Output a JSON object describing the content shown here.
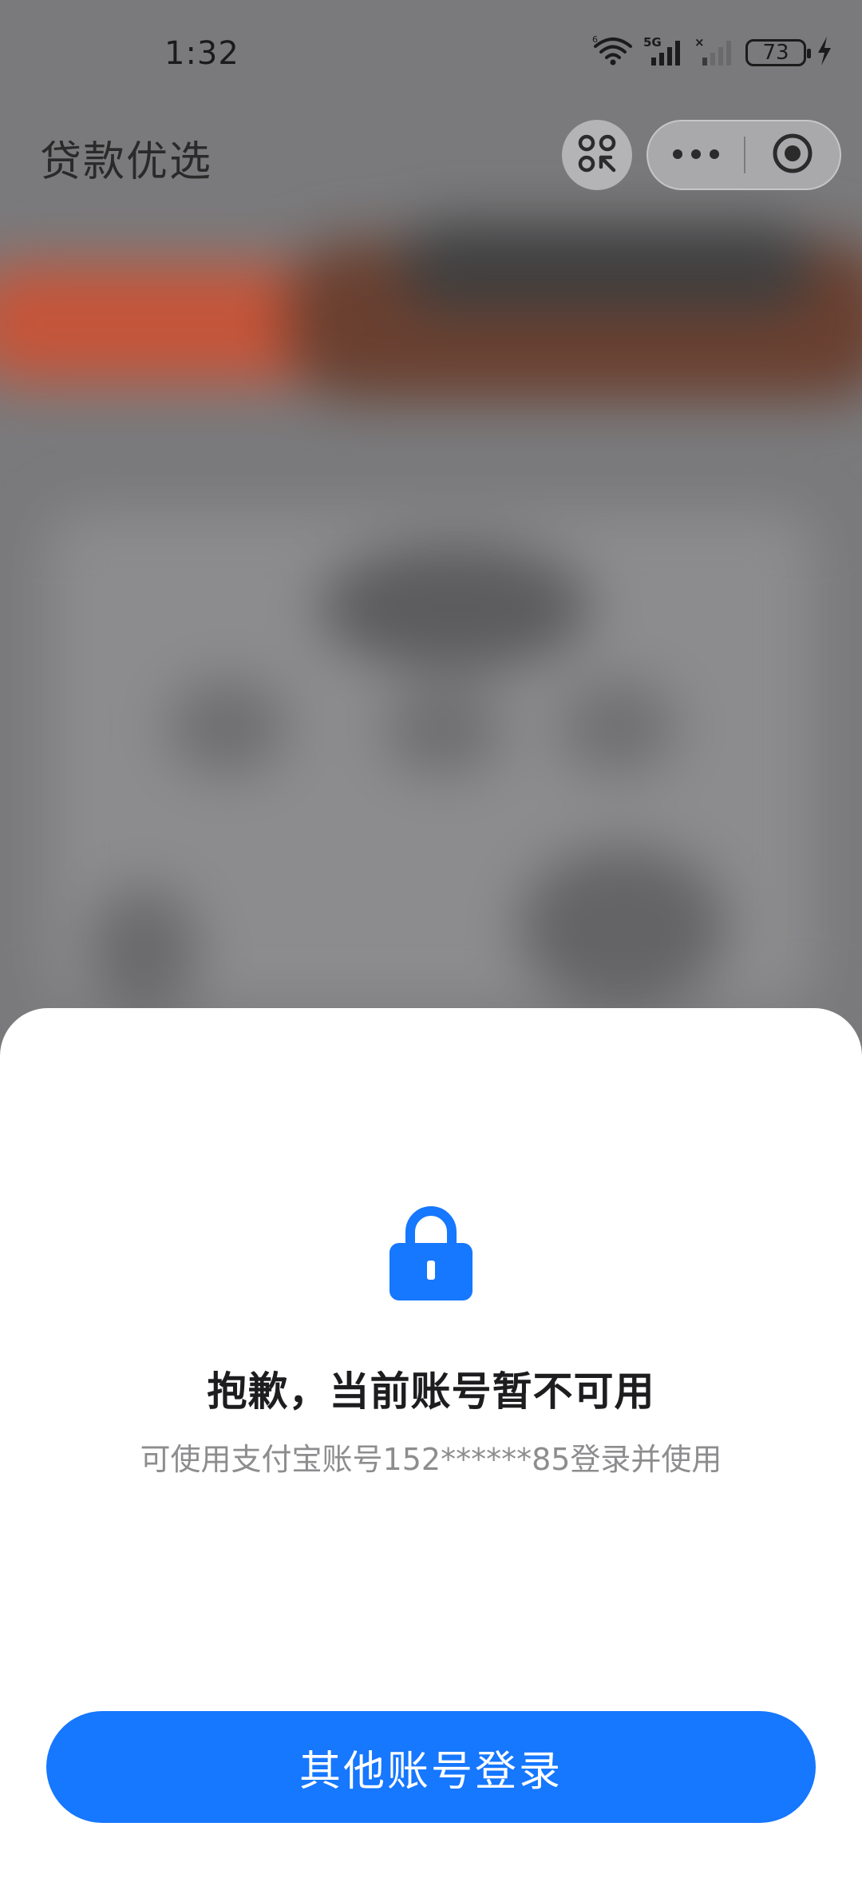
{
  "status_bar": {
    "time": "1:32",
    "battery": "73",
    "icons": [
      "wifi-icon",
      "signal-5g-icon",
      "signal-no-sim-icon",
      "battery-icon",
      "charging-icon"
    ]
  },
  "header": {
    "title": "贷款优选",
    "icons": [
      "scan-icon",
      "more-icon",
      "close-target-icon"
    ]
  },
  "dialog": {
    "icon": "lock-icon",
    "title": "抱歉，当前账号暂不可用",
    "subtitle": "可使用支付宝账号152******85登录并使用",
    "button_label": "其他账号登录"
  },
  "colors": {
    "accent": "#1677ff",
    "overlay": "#7a7a7c",
    "sheet": "#ffffff"
  }
}
